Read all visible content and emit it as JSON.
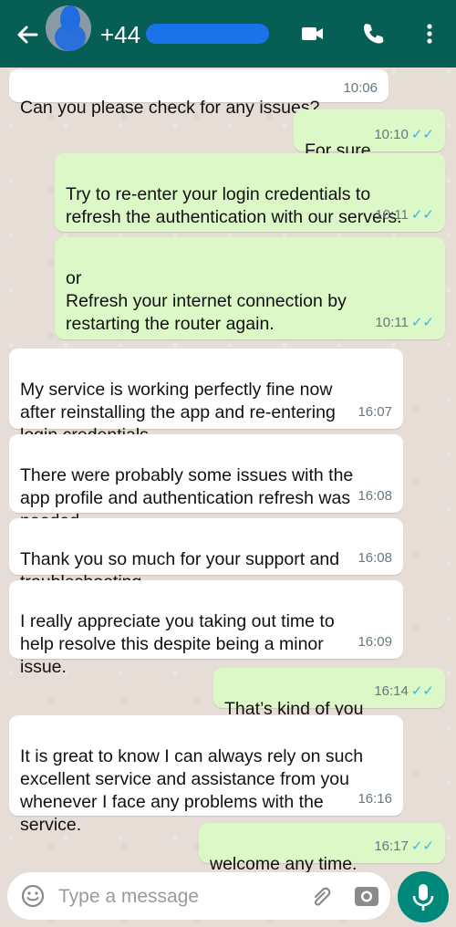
{
  "header": {
    "phone": "+44",
    "colors": {
      "bar": "#075e54",
      "accent": "#00897b",
      "outgoing": "#dcf8c6",
      "ticks": "#34b7f1"
    }
  },
  "messages": [
    {
      "dir": "in",
      "text": "Can you please check for any issues?",
      "time": "10:06"
    },
    {
      "dir": "out",
      "text": "For sure",
      "time": "10:10",
      "ticks": "✓✓"
    },
    {
      "dir": "out",
      "text": "Try to re-enter your login credentials to\nrefresh the authentication with our servers.",
      "time": "10:11",
      "ticks": "✓✓"
    },
    {
      "dir": "out",
      "text": "or\nRefresh your internet connection by\nrestarting the router again.",
      "time": "10:11",
      "ticks": "✓✓"
    },
    {
      "dir": "in",
      "text": "My service is working perfectly fine now\nafter reinstalling the app and re-entering\nlogin credentials.",
      "time": "16:07"
    },
    {
      "dir": "in",
      "text": "There were probably some issues with the\napp profile and authentication refresh was\nneeded.",
      "time": "16:08"
    },
    {
      "dir": "in",
      "text": "Thank you so much for your support and\ntroubleshooting.",
      "time": "16:08"
    },
    {
      "dir": "in",
      "text": " I really appreciate you taking out time to\nhelp resolve this despite being a minor\nissue.",
      "time": "16:09"
    },
    {
      "dir": "out",
      "text": "That’s kind of you",
      "time": "16:14",
      "ticks": "✓✓"
    },
    {
      "dir": "in",
      "text": " It is great to know I can always rely on such\nexcellent service and assistance from you\nwhenever I face any problems with the\nservice.",
      "time": "16:16"
    },
    {
      "dir": "out",
      "text": "welcome any time.",
      "time": "16:17",
      "ticks": "✓✓"
    }
  ],
  "composer": {
    "placeholder": "Type a message"
  },
  "icons": [
    "back-arrow-icon",
    "video-call-icon",
    "phone-call-icon",
    "more-options-icon",
    "emoji-icon",
    "attach-icon",
    "camera-icon",
    "mic-icon"
  ]
}
